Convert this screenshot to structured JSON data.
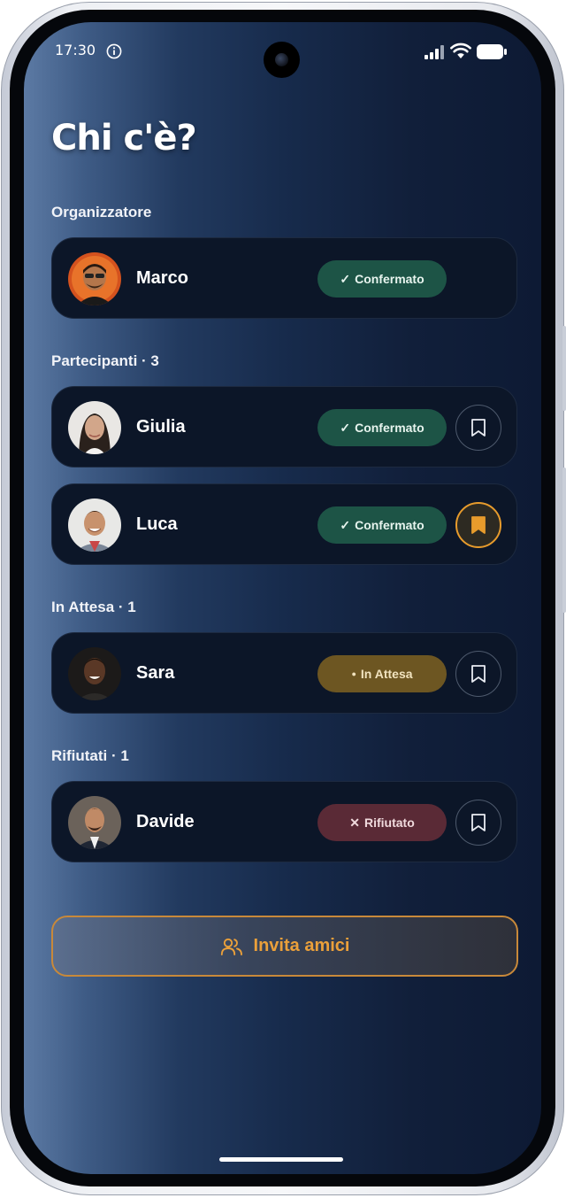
{
  "status_bar": {
    "time": "17:30",
    "icons": [
      "info-icon",
      "signal-icon",
      "wifi-icon",
      "battery-icon"
    ]
  },
  "page": {
    "title": "Chi c'è?"
  },
  "sections": {
    "organizer": {
      "label": "Organizzatore"
    },
    "participants": {
      "label": "Partecipanti · 3"
    },
    "pending": {
      "label": "In Attesa · 1"
    },
    "declined": {
      "label": "Rifiutati · 1"
    }
  },
  "people": [
    {
      "name": "Marco",
      "status": "Confermato",
      "status_icon": "✓",
      "status_kind": "confirmed",
      "bookmark": null
    },
    {
      "name": "Giulia",
      "status": "Confermato",
      "status_icon": "✓",
      "status_kind": "confirmed",
      "bookmark": "off"
    },
    {
      "name": "Luca",
      "status": "Confermato",
      "status_icon": "✓",
      "status_kind": "confirmed",
      "bookmark": "on"
    },
    {
      "name": "Sara",
      "status": "In Attesa",
      "status_icon": "●",
      "status_kind": "pending",
      "bookmark": "off"
    },
    {
      "name": "Davide",
      "status": "Rifiutato",
      "status_icon": "✕",
      "status_kind": "declined",
      "bookmark": "off"
    }
  ],
  "actions": {
    "invite_label": "Invita amici",
    "invite_icon": "users-icon"
  },
  "colors": {
    "confirmed_badge": "#1d5446",
    "pending_badge": "#6d5622",
    "declined_badge": "#5a2a36",
    "accent": "#e79b2c"
  }
}
